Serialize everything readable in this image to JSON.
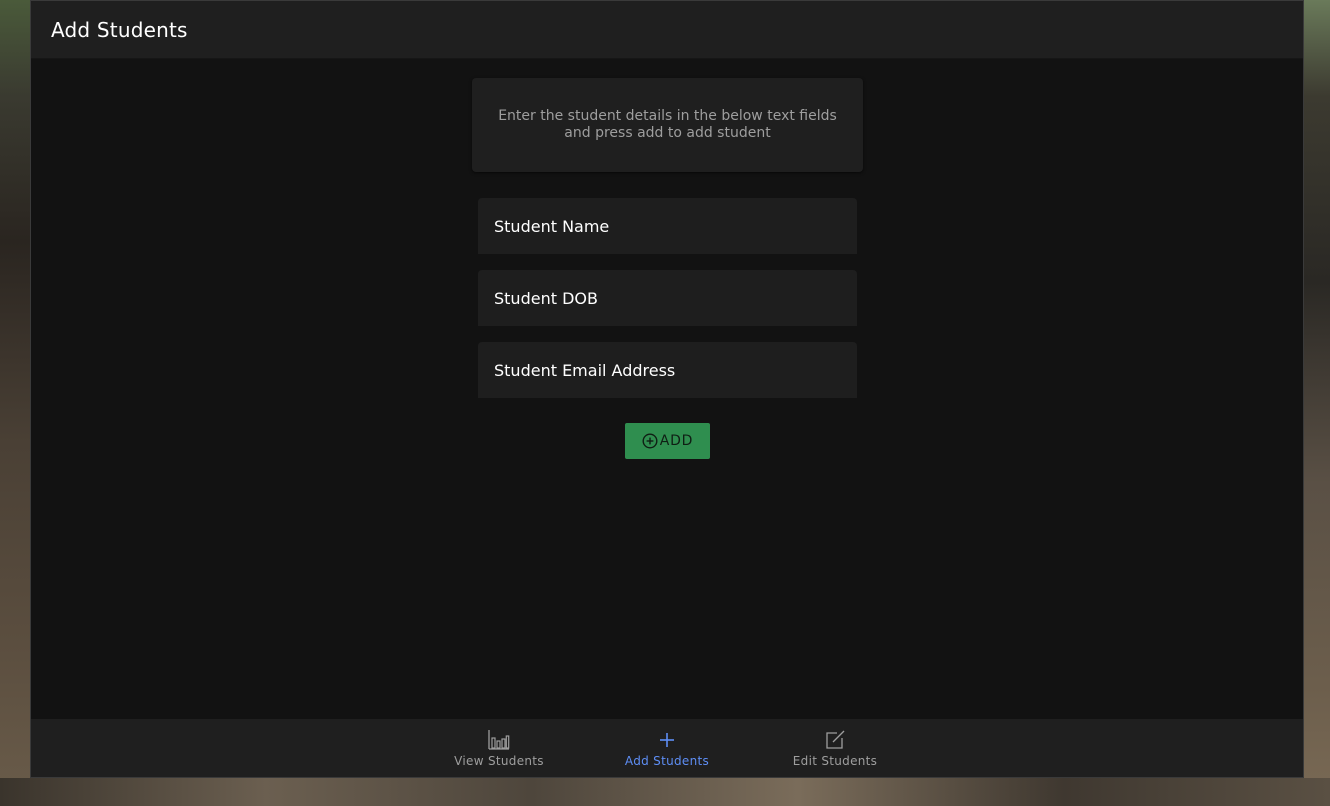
{
  "header": {
    "title": "Add Students"
  },
  "info": {
    "text": "Enter the student details in the below text fields and press add to add student"
  },
  "form": {
    "name_placeholder": "Student Name",
    "name_value": "",
    "dob_placeholder": "Student DOB",
    "dob_value": "",
    "email_placeholder": "Student Email Address",
    "email_value": "",
    "add_label": "ADD",
    "add_icon": "add-circle-icon"
  },
  "nav": {
    "items": [
      {
        "label": "View Students",
        "icon": "bar-chart-icon",
        "active": false
      },
      {
        "label": "Add Students",
        "icon": "plus-icon",
        "active": true
      },
      {
        "label": "Edit Students",
        "icon": "edit-icon",
        "active": false
      }
    ]
  },
  "colors": {
    "background": "#121212",
    "surface": "#1f1f1f",
    "accent": "#5e8ef5",
    "add_button": "#2f8e4f",
    "text_primary": "#ffffff",
    "text_secondary": "#9e9e9e"
  }
}
